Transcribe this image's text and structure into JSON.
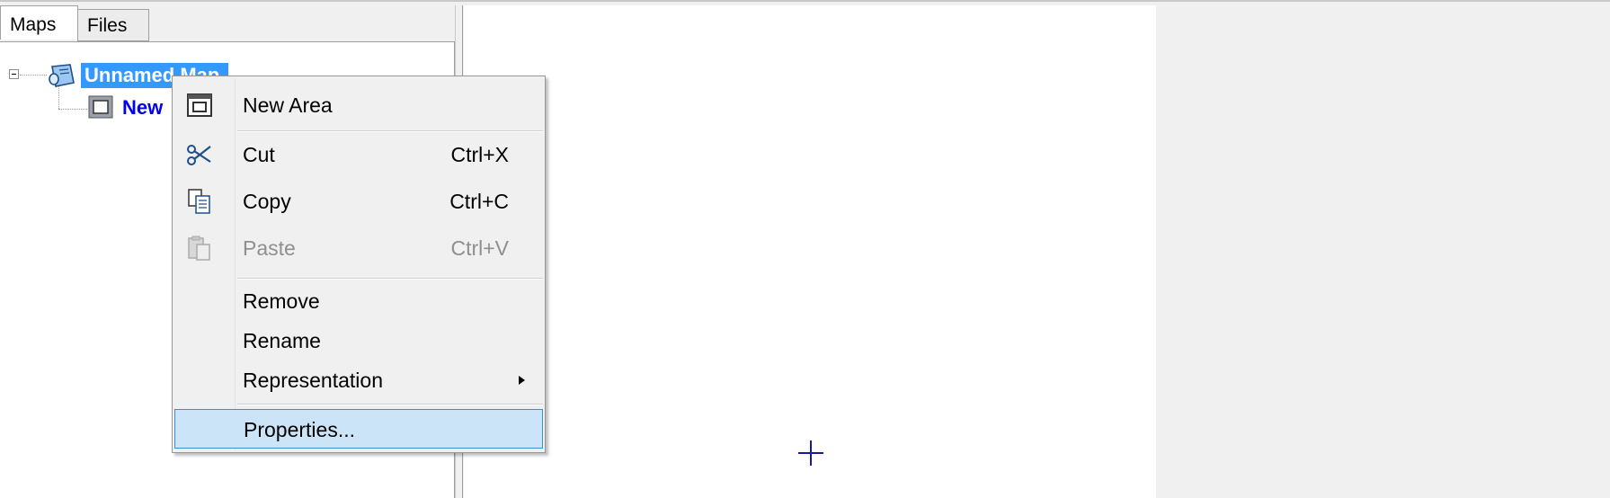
{
  "tabs": [
    {
      "label": "Maps",
      "active": true
    },
    {
      "label": "Files",
      "active": false
    }
  ],
  "tree": {
    "root_label": "Unnamed Map",
    "child_label": "New"
  },
  "context_menu": {
    "items": [
      {
        "label": "New Area",
        "shortcut": "",
        "icon": "new-area-icon",
        "enabled": true
      },
      {
        "label": "Cut",
        "shortcut": "Ctrl+X",
        "icon": "scissors-icon",
        "enabled": true
      },
      {
        "label": "Copy",
        "shortcut": "Ctrl+C",
        "icon": "copy-icon",
        "enabled": true
      },
      {
        "label": "Paste",
        "shortcut": "Ctrl+V",
        "icon": "paste-icon",
        "enabled": false
      },
      {
        "label": "Remove",
        "shortcut": "",
        "enabled": true
      },
      {
        "label": "Rename",
        "shortcut": "",
        "enabled": true
      },
      {
        "label": "Representation",
        "shortcut": "",
        "submenu": true,
        "enabled": true
      },
      {
        "label": "Properties...",
        "shortcut": "",
        "enabled": true,
        "highlighted": true
      }
    ]
  },
  "colors": {
    "selection": "#3399ff",
    "child_node_text": "#0000ee",
    "menu_highlight": "#cce4f7",
    "menu_highlight_border": "#3a8fdb",
    "crosshair": "#1a1aa0"
  }
}
